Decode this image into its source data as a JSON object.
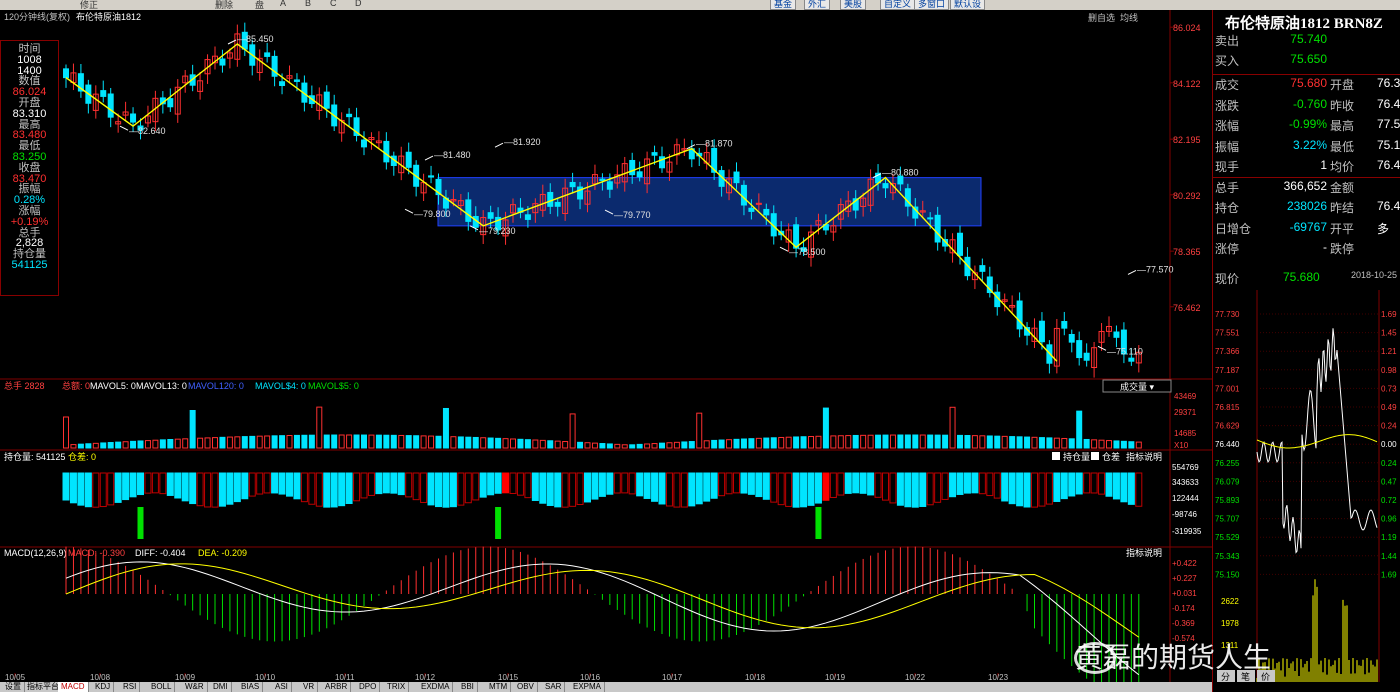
{
  "toolbar": {
    "items": [
      "修正",
      "删除",
      "盘",
      "A",
      "B",
      "C",
      "D"
    ],
    "buttons": [
      "基金",
      "外汇",
      "美股",
      "自定义",
      "多窗口",
      "默认设"
    ],
    "right_buttons": [
      "删自选",
      "均线"
    ],
    "period_label": "120分钟线(复权)",
    "instrument_label": "布伦特原油1812"
  },
  "ohlc_panel": {
    "time_label": "时间",
    "time_value_1": "1008",
    "time_value_2": "1400",
    "value_label": "数值",
    "value": "86.024",
    "open_label": "开盘",
    "open": "83.310",
    "high_label": "最高",
    "high": "83.480",
    "low_label": "最低",
    "low": "83.250",
    "close_label": "收盘",
    "close": "83.470",
    "amp_label": "振幅",
    "amp": "0.28%",
    "chg_label": "涨幅",
    "chg": "+0.19%",
    "vol_label": "总手",
    "vol": "2,828",
    "oi_label": "持仓量",
    "oi": "541125"
  },
  "chart_data": {
    "type": "candlestick",
    "title": "布伦特原油1812",
    "price_axis_ticks": [
      "86.024",
      "84.122",
      "82.195",
      "80.292",
      "78.365",
      "76.462"
    ],
    "price_range": [
      74.3,
      86.1
    ],
    "date_ticks": [
      "10/05",
      "10/08",
      "10/09",
      "10/10",
      "10/11",
      "10/12",
      "10/15",
      "10/16",
      "10/17",
      "10/18",
      "10/19",
      "10/22",
      "10/23"
    ],
    "swing_points": [
      {
        "label": "82.640",
        "value": 82.64
      },
      {
        "label": "85.450",
        "value": 85.45
      },
      {
        "label": "81.480",
        "value": 81.48
      },
      {
        "label": "79.800",
        "value": 79.8
      },
      {
        "label": "81.920",
        "value": 81.92
      },
      {
        "label": "79.230",
        "value": 79.23
      },
      {
        "label": "79.770",
        "value": 79.77
      },
      {
        "label": "81.870",
        "value": 81.87
      },
      {
        "label": "78.500",
        "value": 78.5
      },
      {
        "label": "80.880",
        "value": 80.88
      },
      {
        "label": "75.110",
        "value": 75.11
      },
      {
        "label": "77.570",
        "value": 77.57
      }
    ],
    "zigzag": [
      84.3,
      82.64,
      85.45,
      79.23,
      81.87,
      78.5,
      80.88,
      74.6
    ],
    "range_box": {
      "high": 80.88,
      "low": 79.23
    },
    "volume_header": {
      "vol_label": "总手",
      "vol": "2828",
      "amt_label": "总额",
      "amt": "0",
      "ma5": "MAVOL5: 0",
      "ma13": "MAVOL13: 0",
      "ma120": "MAVOL120: 0",
      "ma4": "MAVOL$4: 0",
      "ma5b": "MAVOL$5: 0",
      "dropdown": "成交量"
    },
    "volume_ticks": [
      "43469",
      "29371",
      "14685",
      "X10"
    ],
    "oi_header": {
      "label": "持仓量: 541125",
      "diff_label": "仓差: 0",
      "check1": "持仓量",
      "check2": "仓差",
      "explain": "指标说明"
    },
    "oi_ticks": [
      "554769",
      "343633",
      "122444",
      "-98746",
      "-319935"
    ],
    "macd_header": {
      "label": "MACD(12,26,9)",
      "macd": "MACD: -0.390",
      "diff": "DIFF: -0.404",
      "dea": "DEA: -0.209",
      "explain": "指标说明"
    },
    "macd_ticks": [
      "+0.422",
      "+0.227",
      "+0.031",
      "-0.174",
      "-0.369",
      "-0.574"
    ]
  },
  "quote_panel": {
    "title": "布伦特原油1812 BRN8Z",
    "sell_label": "卖出",
    "sell": "75.740",
    "buy_label": "买入",
    "buy": "75.650",
    "rows": [
      {
        "l1": "成交",
        "v1": "75.680",
        "c1": "up",
        "l2": "开盘",
        "v2": "76.3"
      },
      {
        "l1": "涨跌",
        "v1": "-0.760",
        "c1": "dn",
        "l2": "昨收",
        "v2": "76.4"
      },
      {
        "l1": "涨幅",
        "v1": "-0.99%",
        "c1": "dn",
        "l2": "最高",
        "v2": "77.5"
      },
      {
        "l1": "振幅",
        "v1": "3.22%",
        "c1": "cy",
        "l2": "最低",
        "v2": "75.1"
      },
      {
        "l1": "现手",
        "v1": "1",
        "c1": "wh",
        "l2": "均价",
        "v2": "76.4"
      },
      {
        "l1": "总手",
        "v1": "366,652",
        "c1": "wh",
        "l2": "金额",
        "v2": ""
      },
      {
        "l1": "持仓",
        "v1": "238026",
        "c1": "cy",
        "l2": "昨结",
        "v2": "76.4"
      },
      {
        "l1": "日增仓",
        "v1": "-69767",
        "c1": "cy",
        "l2": "开平",
        "v2": "多"
      },
      {
        "l1": "涨停",
        "v1": "-",
        "c1": "wh",
        "l2": "跌停",
        "v2": ""
      }
    ],
    "cur_label": "现价",
    "cur": "75.680",
    "date": "2018-10-25",
    "mini_ticks": [
      "77.730",
      "77.551",
      "77.366",
      "77.187",
      "77.001",
      "76.815",
      "76.629",
      "76.440",
      "76.255",
      "76.079",
      "75.893",
      "75.707",
      "75.529",
      "75.343",
      "75.150"
    ],
    "mini_pct": [
      "1.69",
      "1.45",
      "1.21",
      "0.98",
      "0.73",
      "0.49",
      "0.24",
      "0.00",
      "0.24",
      "0.47",
      "0.72",
      "0.96",
      "1.19",
      "1.44",
      "1.69"
    ],
    "mini_vol_ticks": [
      "2622",
      "1978",
      "1311"
    ],
    "bottom_tabs": [
      "分",
      "笔",
      "价"
    ]
  },
  "bottom_tabs": [
    "设置",
    "指标平台",
    "MACD",
    "KDJ",
    "RSI",
    "BOLL",
    "W&R",
    "DMI",
    "BIAS",
    "ASI",
    "VR",
    "ARBR",
    "DPO",
    "TRIX",
    "EXDMA",
    "BBI",
    "MTM",
    "OBV",
    "SAR",
    "EXPMA"
  ],
  "watermark": "黄磊的期货人生",
  "colors": {
    "up": "#ff3030",
    "down": "#00e5ff",
    "zigzag": "#ffff00",
    "box": "#0b2a6e",
    "grid": "#800000"
  }
}
